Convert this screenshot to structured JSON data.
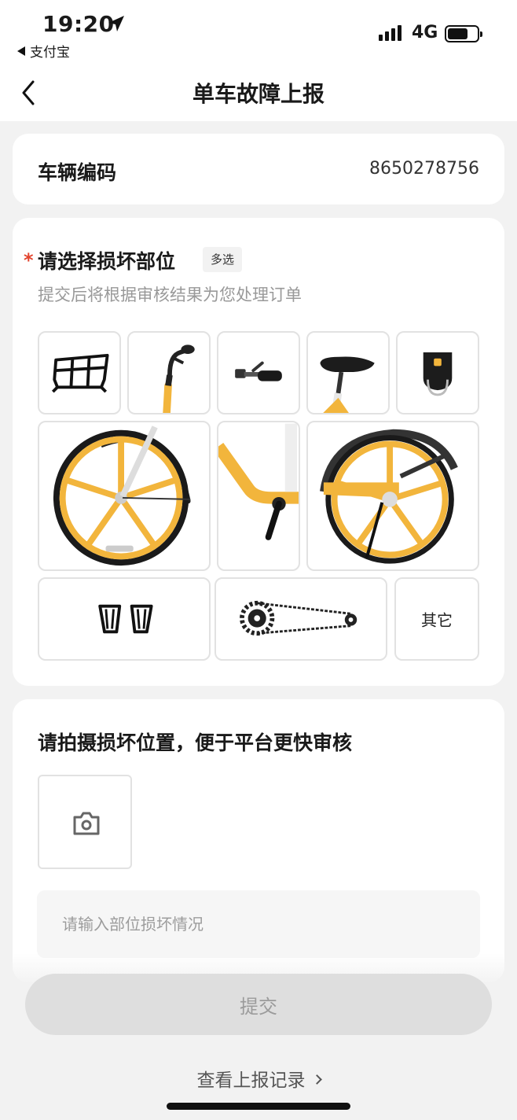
{
  "status_bar": {
    "time": "19:20",
    "back_app": "支付宝",
    "network": "4G",
    "battery_level": 0.7
  },
  "nav": {
    "title": "单车故障上报"
  },
  "vehicle": {
    "label": "车辆编码",
    "code": "8650278756"
  },
  "parts_section": {
    "required_mark": "*",
    "title": "请选择损坏部位",
    "badge": "多选",
    "subtitle": "提交后将根据审核结果为您处理订单",
    "parts": [
      {
        "icon": "basket-icon"
      },
      {
        "icon": "handlebar-icon"
      },
      {
        "icon": "brake-lever-icon"
      },
      {
        "icon": "seat-icon"
      },
      {
        "icon": "lock-icon"
      },
      {
        "icon": "front-wheel-icon"
      },
      {
        "icon": "frame-crank-icon"
      },
      {
        "icon": "rear-wheel-icon"
      },
      {
        "icon": "pedals-icon"
      },
      {
        "icon": "chain-icon"
      },
      {
        "label": "其它"
      }
    ]
  },
  "photo_section": {
    "title": "请拍摄损坏位置，便于平台更快审核",
    "input_placeholder": "请输入部位损坏情况"
  },
  "actions": {
    "submit_label": "提交",
    "history_label": "查看上报记录"
  },
  "colors": {
    "accent_required": "#e2442e",
    "bike_yellow": "#f2b53c",
    "button_disabled": "#dedede"
  }
}
